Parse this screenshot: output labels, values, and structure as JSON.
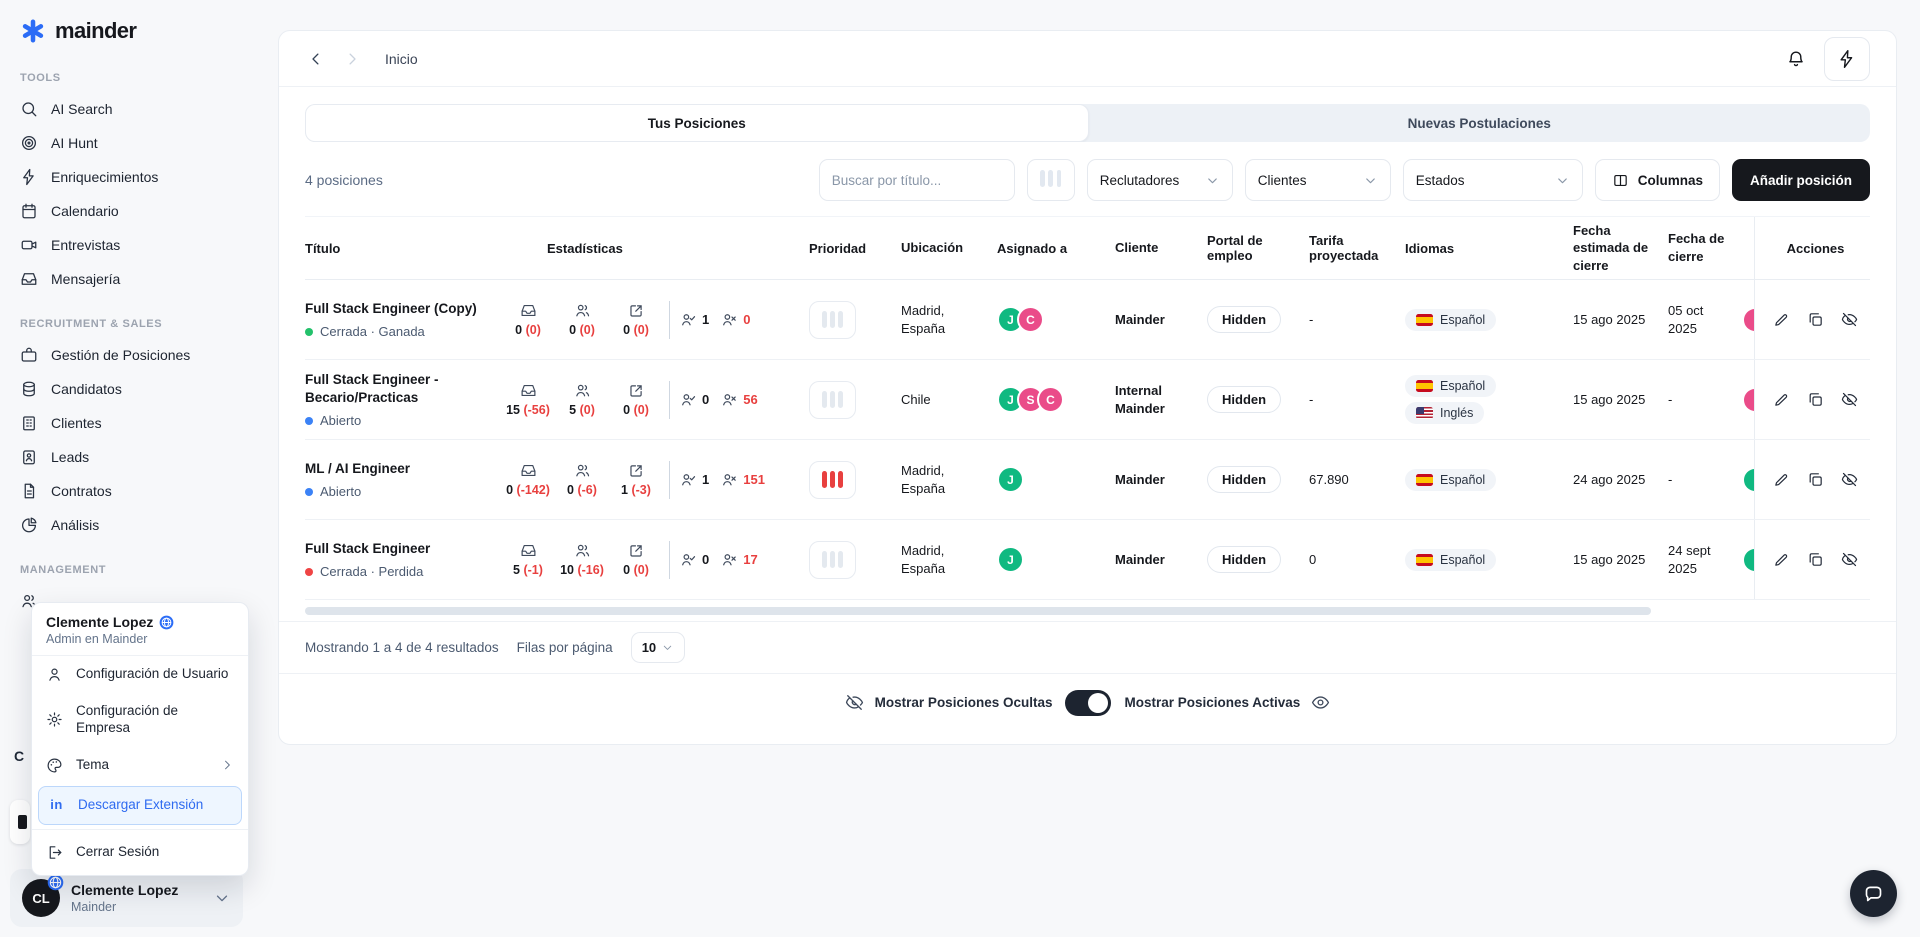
{
  "brand": {
    "name": "mainder"
  },
  "topbar": {
    "breadcrumb": "Inicio"
  },
  "sidebar": {
    "sections": [
      {
        "label": "TOOLS",
        "items": [
          {
            "icon": "search-icon",
            "label": "AI Search"
          },
          {
            "icon": "target-icon",
            "label": "AI Hunt"
          },
          {
            "icon": "bolt-icon",
            "label": "Enriquecimientos"
          },
          {
            "icon": "calendar-icon",
            "label": "Calendario"
          },
          {
            "icon": "video-camera-icon",
            "label": "Entrevistas"
          },
          {
            "icon": "inbox-icon",
            "label": "Mensajería"
          }
        ]
      },
      {
        "label": "RECRUITMENT & SALES",
        "items": [
          {
            "icon": "briefcase-icon",
            "label": "Gestión de Posiciones"
          },
          {
            "icon": "database-icon",
            "label": "Candidatos"
          },
          {
            "icon": "building-icon",
            "label": "Clientes"
          },
          {
            "icon": "id-badge-icon",
            "label": "Leads"
          },
          {
            "icon": "document-icon",
            "label": "Contratos"
          },
          {
            "icon": "pie-chart-icon",
            "label": "Análisis"
          }
        ]
      },
      {
        "label": "MANAGEMENT",
        "items": []
      }
    ],
    "fragment_text": "C",
    "user_chip": {
      "initials": "CL",
      "name": "Clemente Lopez",
      "org": "Mainder"
    }
  },
  "tabs": {
    "active": "Tus Posiciones",
    "inactive": "Nuevas Postulaciones"
  },
  "filters": {
    "count": "4 posiciones",
    "search_placeholder": "Buscar por título...",
    "recruiters": "Reclutadores",
    "clients": "Clientes",
    "states": "Estados",
    "columns": "Columnas",
    "add_position": "Añadir posición"
  },
  "table": {
    "headers": [
      "Título",
      "Estadísticas",
      "Prioridad",
      "Ubicación",
      "Asignado a",
      "Cliente",
      "Portal de empleo",
      "Tarifa proyectada",
      "Idiomas",
      "Fecha estimada de cierre",
      "Fecha de cierre",
      "Acciones"
    ],
    "rows": [
      {
        "title": "Full Stack Engineer (Copy)",
        "status": {
          "label": "Cerrada · Ganada",
          "color": "#23c16b"
        },
        "stats": [
          {
            "value": "0",
            "delta": "(0)"
          },
          {
            "value": "0",
            "delta": "(0)"
          },
          {
            "value": "0",
            "delta": "(0)"
          }
        ],
        "accepted": "1",
        "rejected": "0",
        "priority_color": "#e4e9ef",
        "location": "Madrid, España",
        "assignees": [
          {
            "initial": "J",
            "color": "#10b981"
          },
          {
            "initial": "C",
            "color": "#ea4c89"
          }
        ],
        "client": "Mainder",
        "portal": "Hidden",
        "rate": "-",
        "languages": [
          {
            "label": "Español",
            "flag": "es"
          }
        ],
        "est_close": "15 ago 2025",
        "close": "05 oct 2025",
        "sliver_color": "#ea4c89"
      },
      {
        "title": "Full Stack Engineer - Becario/Practicas",
        "status": {
          "label": "Abierto",
          "color": "#3b82f6"
        },
        "stats": [
          {
            "value": "15",
            "delta": "(-56)"
          },
          {
            "value": "5",
            "delta": "(0)"
          },
          {
            "value": "0",
            "delta": "(0)"
          }
        ],
        "accepted": "0",
        "rejected": "56",
        "priority_color": "#e4e9ef",
        "location": "Chile",
        "assignees": [
          {
            "initial": "J",
            "color": "#10b981"
          },
          {
            "initial": "S",
            "color": "#ea4c89"
          },
          {
            "initial": "C",
            "color": "#ea4c89"
          }
        ],
        "client": "Internal Mainder",
        "portal": "Hidden",
        "rate": "-",
        "languages": [
          {
            "label": "Español",
            "flag": "es"
          },
          {
            "label": "Inglés",
            "flag": "us"
          }
        ],
        "est_close": "15 ago 2025",
        "close": "-",
        "sliver_color": "#ea4c89"
      },
      {
        "title": "ML / AI Engineer",
        "status": {
          "label": "Abierto",
          "color": "#3b82f6"
        },
        "stats": [
          {
            "value": "0",
            "delta": "(-142)"
          },
          {
            "value": "0",
            "delta": "(-6)"
          },
          {
            "value": "1",
            "delta": "(-3)"
          }
        ],
        "accepted": "1",
        "rejected": "151",
        "priority_color": "#e8403f",
        "location": "Madrid, España",
        "assignees": [
          {
            "initial": "J",
            "color": "#10b981"
          }
        ],
        "client": "Mainder",
        "portal": "Hidden",
        "rate": "67.890",
        "languages": [
          {
            "label": "Español",
            "flag": "es"
          }
        ],
        "est_close": "24 ago 2025",
        "close": "-",
        "sliver_color": "#10b981"
      },
      {
        "title": "Full Stack Engineer",
        "status": {
          "label": "Cerrada · Perdida",
          "color": "#ef4444"
        },
        "stats": [
          {
            "value": "5",
            "delta": "(-1)"
          },
          {
            "value": "10",
            "delta": "(-16)"
          },
          {
            "value": "0",
            "delta": "(0)"
          }
        ],
        "accepted": "0",
        "rejected": "17",
        "priority_color": "#e4e9ef",
        "location": "Madrid, España",
        "assignees": [
          {
            "initial": "J",
            "color": "#10b981"
          }
        ],
        "client": "Mainder",
        "portal": "Hidden",
        "rate": "0",
        "languages": [
          {
            "label": "Español",
            "flag": "es"
          }
        ],
        "est_close": "15 ago 2025",
        "close": "24 sept 2025",
        "sliver_color": "#10b981"
      }
    ],
    "footer": {
      "showing": "Mostrando 1 a 4 de 4 resultados",
      "rows_per_page_label": "Filas por página",
      "rows_per_page": "10"
    },
    "toggles": {
      "hidden_label": "Mostrar Posiciones Ocultas",
      "active_label": "Mostrar Posiciones Activas"
    }
  },
  "user_menu": {
    "name": "Clemente Lopez",
    "subtitle": "Admin en Mainder",
    "items": {
      "user_settings": "Configuración de Usuario",
      "company_settings": "Configuración de Empresa",
      "theme": "Tema",
      "download_extension": "Descargar Extensión",
      "logout": "Cerrar Sesión"
    }
  },
  "colors": {
    "accent_blue": "#2f6bf0",
    "green": "#10b981",
    "pink": "#ea4c89",
    "red": "#e8403f",
    "dark": "#16181d"
  }
}
